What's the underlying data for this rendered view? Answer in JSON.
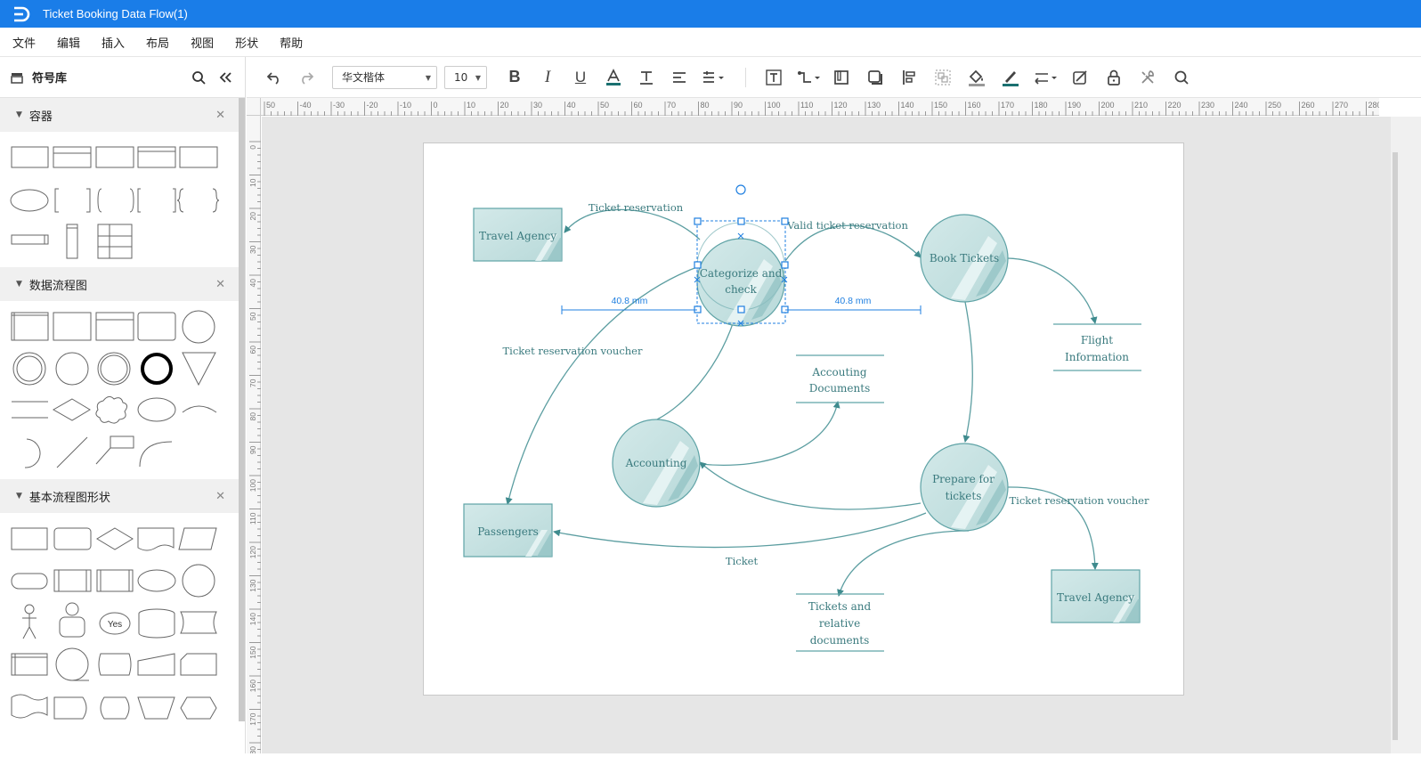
{
  "app": {
    "title": "Ticket Booking Data Flow(1)"
  },
  "menu": [
    "文件",
    "编辑",
    "插入",
    "布局",
    "视图",
    "形状",
    "帮助"
  ],
  "sidebar": {
    "title": "符号库",
    "sections": [
      {
        "label": "容器"
      },
      {
        "label": "数据流程图"
      },
      {
        "label": "基本流程图形状"
      }
    ],
    "yes_label": "Yes"
  },
  "toolbar": {
    "font": "华文楷体",
    "size": "10"
  },
  "diagram": {
    "nodes": {
      "travel_agency_1": "Travel Agency",
      "categorize_line1": "Categorize and",
      "categorize_line2": "check",
      "book_tickets": "Book Tickets",
      "flight_line1": "Flight",
      "flight_line2": "Information",
      "accouting_line1": "Accouting",
      "accouting_line2": "Documents",
      "accounting": "Accounting",
      "prepare_line1": "Prepare for",
      "prepare_line2": "tickets",
      "passengers": "Passengers",
      "travel_agency_2": "Travel Agency",
      "tickets_line1": "Tickets and",
      "tickets_line2": "relative",
      "tickets_line3": "documents"
    },
    "labels": {
      "ticket_reservation": "Ticket reservation",
      "valid_ticket_reservation": "Valid ticket reservation",
      "voucher_left": "Ticket reservation voucher",
      "voucher_right": "Ticket reservation voucher",
      "ticket": "Ticket",
      "dim_left": "40.8 mm",
      "dim_right": "40.8 mm"
    }
  },
  "colors": {
    "titlebar": "#1a7de8",
    "shape_fill": "#cde5e5",
    "shape_stroke": "#5fa3a6",
    "selection": "#1f7fe0"
  },
  "rulers": {
    "top": [
      "50",
      "-40",
      "-30",
      "-20",
      "-10",
      "0",
      "10",
      "20",
      "30",
      "40",
      "50",
      "60",
      "70",
      "80",
      "90",
      "100",
      "110",
      "120",
      "130",
      "140",
      "150",
      "160",
      "170",
      "180",
      "190",
      "200",
      "210",
      "220",
      "230",
      "240",
      "250",
      "260",
      "270",
      "280"
    ],
    "left": [
      "0",
      "10",
      "20",
      "30",
      "40",
      "50",
      "60",
      "70",
      "80",
      "90",
      "100",
      "110",
      "120",
      "130",
      "140",
      "150",
      "160",
      "170",
      "180"
    ]
  }
}
